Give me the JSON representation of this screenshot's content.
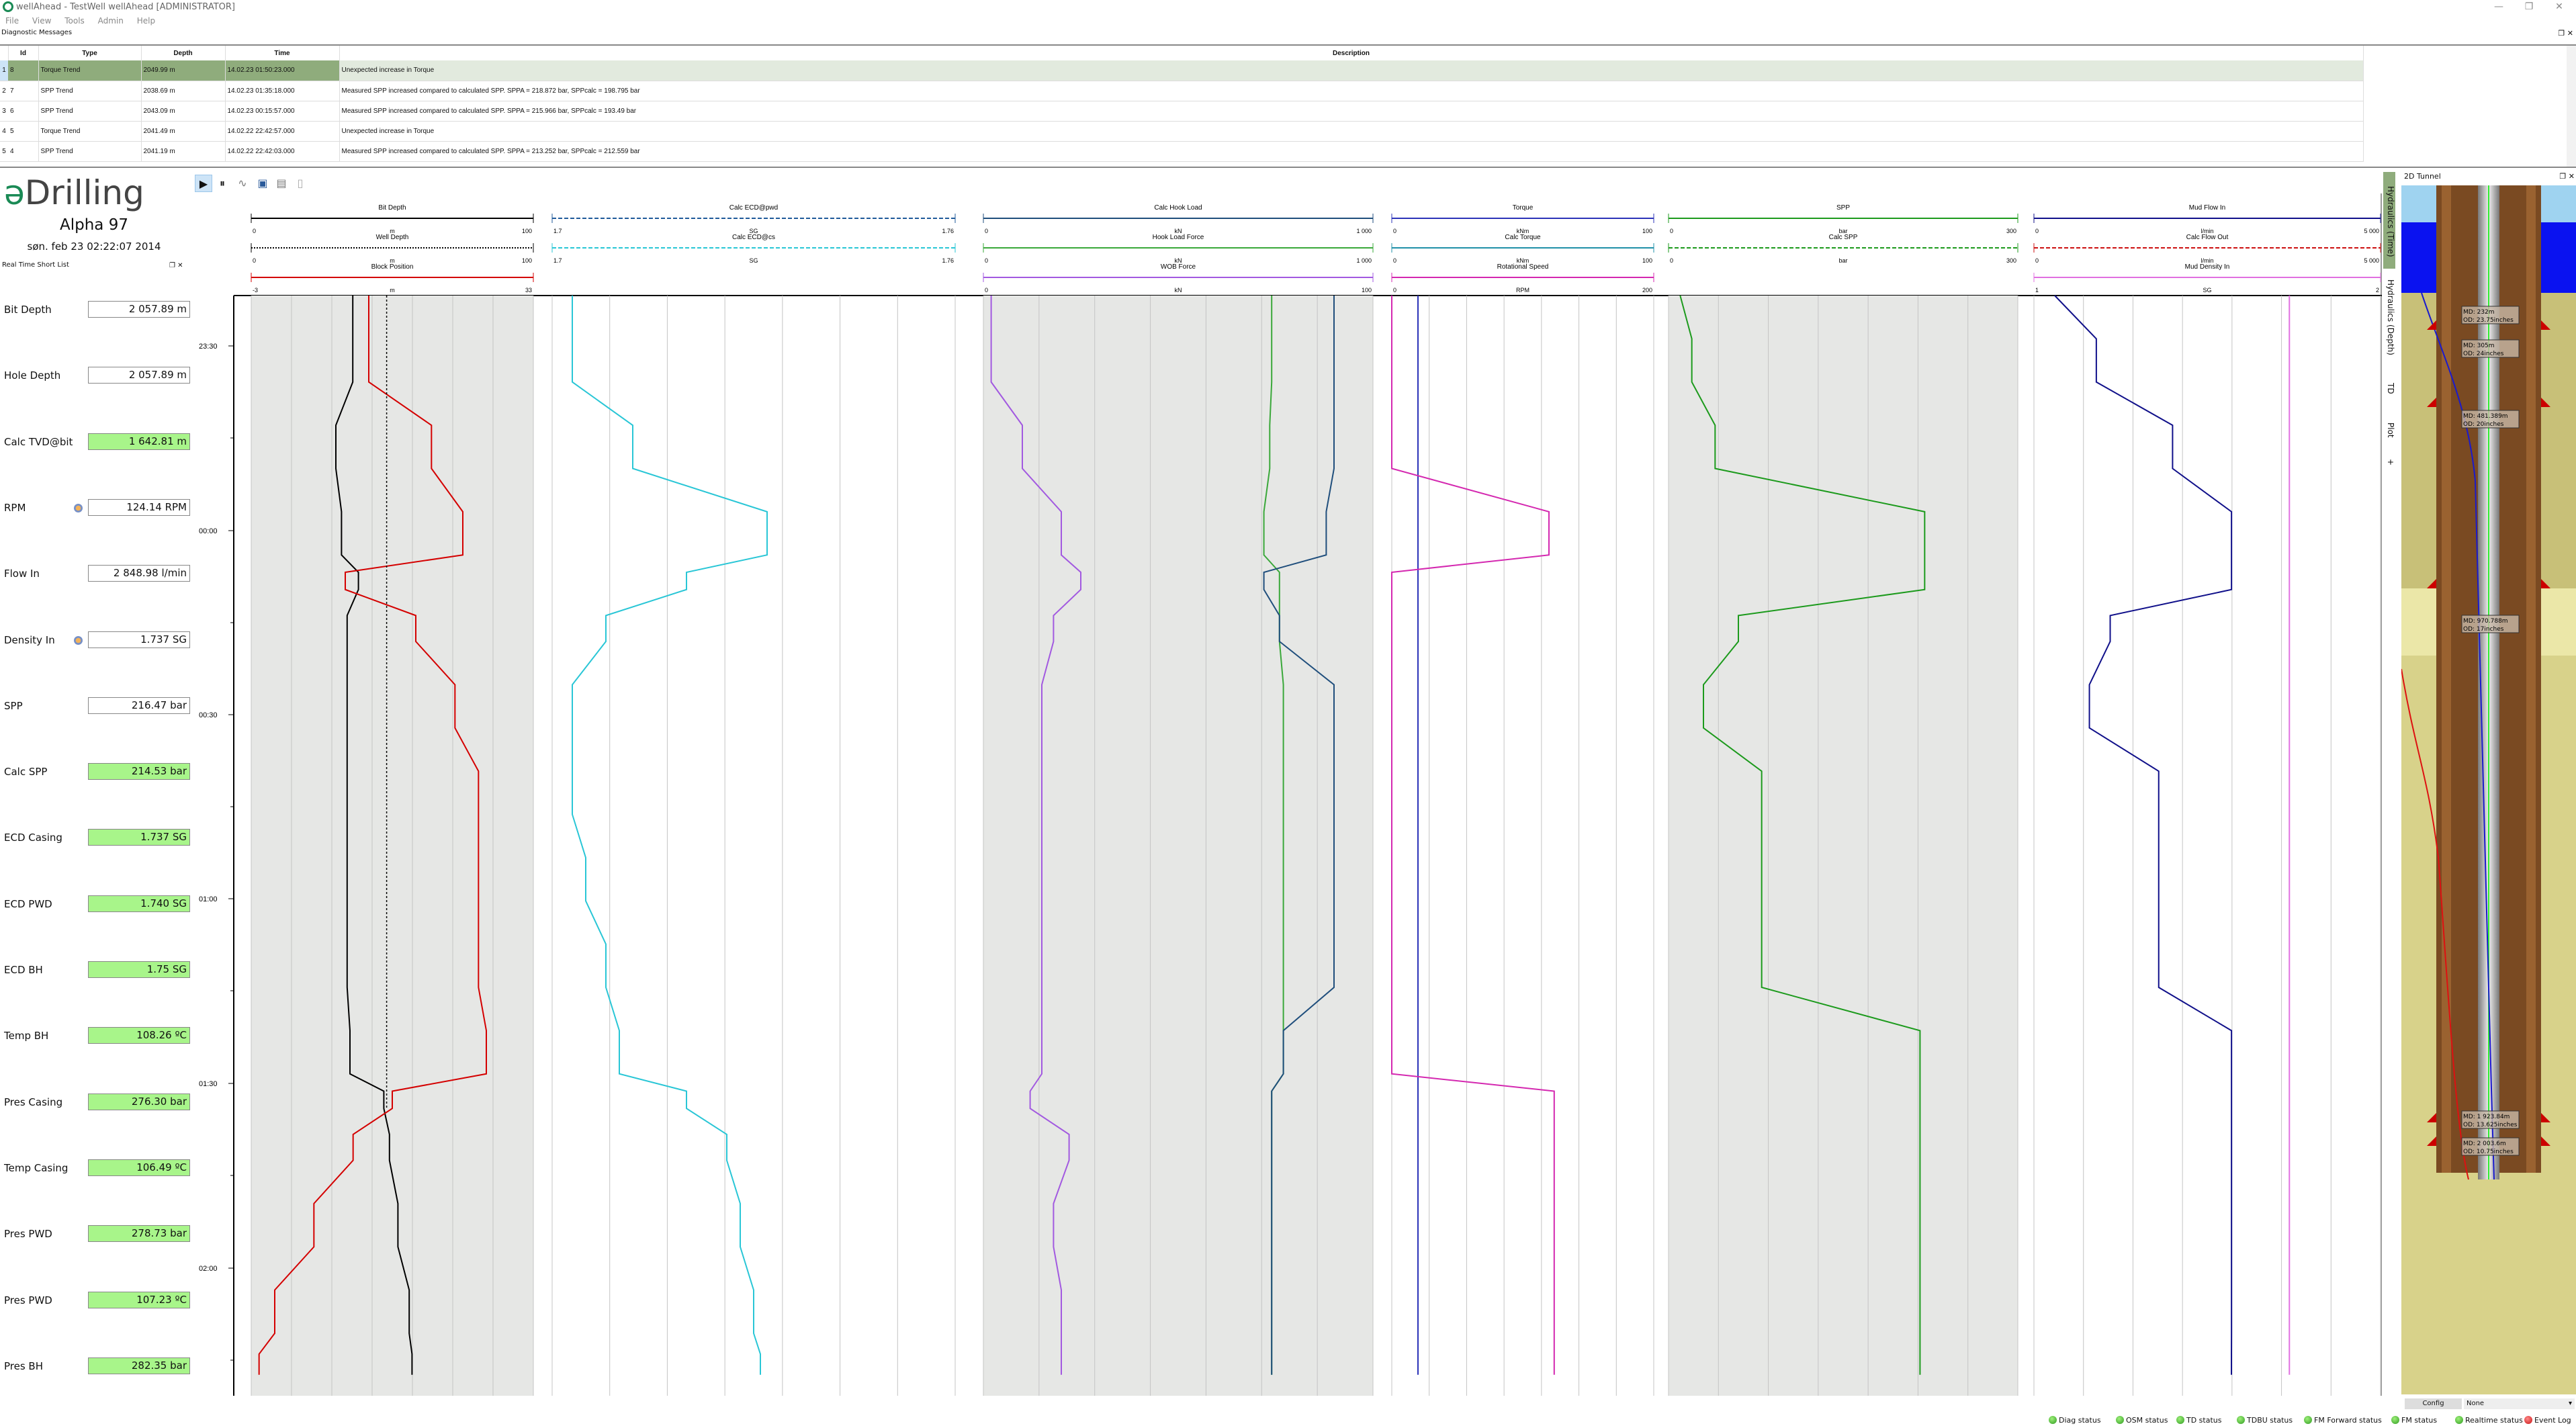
{
  "window": {
    "title": "wellAhead - TestWell wellAhead [ADMINISTRATOR]",
    "controls": {
      "minimize": "—",
      "restore": "❐",
      "close": "✕"
    }
  },
  "menu": [
    "File",
    "View",
    "Tools",
    "Admin",
    "Help"
  ],
  "diagnostics": {
    "panel_title": "Diagnostic Messages",
    "columns": [
      "Id",
      "Type",
      "Depth",
      "Time",
      "Description"
    ],
    "rows": [
      {
        "row": "1",
        "id": "8",
        "type": "Torque Trend",
        "depth": "2049.99 m",
        "time": "14.02.23 01:50:23.000",
        "description": "Unexpected increase in Torque",
        "selected": true
      },
      {
        "row": "2",
        "id": "7",
        "type": "SPP Trend",
        "depth": "2038.69 m",
        "time": "14.02.23 01:35:18.000",
        "description": "Measured SPP increased compared to calculated SPP. SPPA = 218.872 bar, SPPcalc = 198.795 bar"
      },
      {
        "row": "3",
        "id": "6",
        "type": "SPP Trend",
        "depth": "2043.09 m",
        "time": "14.02.23 00:15:57.000",
        "description": "Measured SPP increased compared to calculated SPP. SPPA = 215.966 bar, SPPcalc = 193.49 bar"
      },
      {
        "row": "4",
        "id": "5",
        "type": "Torque Trend",
        "depth": "2041.49 m",
        "time": "14.02.22 22:42:57.000",
        "description": "Unexpected increase in Torque"
      },
      {
        "row": "5",
        "id": "4",
        "type": "SPP Trend",
        "depth": "2041.19 m",
        "time": "14.02.22 22:42:03.000",
        "description": "Measured SPP increased compared to calculated SPP. SPPA = 213.252 bar, SPPcalc = 212.559 bar"
      }
    ]
  },
  "brand": {
    "prefix": "ə",
    "name": "Drilling"
  },
  "rig_name": "Alpha 97",
  "datetime": "søn. feb 23 02:22:07 2014",
  "short_list": {
    "title": "Real Time Short List",
    "items": [
      {
        "label": "Bit Depth",
        "value": "2 057.89 m",
        "status": "normal"
      },
      {
        "label": "Hole Depth",
        "value": "2 057.89 m",
        "status": "normal"
      },
      {
        "label": "Calc TVD@bit",
        "value": "1 642.81 m",
        "status": "ok"
      },
      {
        "label": "RPM",
        "value": "124.14 RPM",
        "status": "normal",
        "gauge": true
      },
      {
        "label": "Flow In",
        "value": "2 848.98 l/min",
        "status": "normal"
      },
      {
        "label": "Density In",
        "value": "1.737 SG",
        "status": "normal",
        "gauge": true
      },
      {
        "label": "SPP",
        "value": "216.47 bar",
        "status": "normal"
      },
      {
        "label": "Calc SPP",
        "value": "214.53 bar",
        "status": "ok"
      },
      {
        "label": "ECD Casing",
        "value": "1.737 SG",
        "status": "ok"
      },
      {
        "label": "ECD PWD",
        "value": "1.740 SG",
        "status": "ok"
      },
      {
        "label": "ECD BH",
        "value": "1.75 SG",
        "status": "ok"
      },
      {
        "label": "Temp BH",
        "value": "108.26 ºC",
        "status": "ok"
      },
      {
        "label": "Pres Casing",
        "value": "276.30 bar",
        "status": "ok"
      },
      {
        "label": "Temp Casing",
        "value": "106.49 ºC",
        "status": "ok"
      },
      {
        "label": "Pres PWD",
        "value": "278.73 bar",
        "status": "ok"
      },
      {
        "label": "Pres PWD",
        "value": "107.23 ºC",
        "status": "ok"
      },
      {
        "label": "Pres BH",
        "value": "282.35 bar",
        "status": "ok"
      }
    ]
  },
  "toolbar": {
    "play": "play-icon",
    "pause": "pause-icon",
    "signal": "wave-icon",
    "save": "save-icon",
    "print": "print-icon",
    "copy": "copy-icon"
  },
  "time_axis": {
    "labels": [
      "23:30",
      "00:00",
      "00:30",
      "01:00",
      "01:30",
      "02:00"
    ]
  },
  "tracks": [
    {
      "id": "depth",
      "shaded": true,
      "curves": [
        {
          "name": "Bit Depth",
          "unit": "m",
          "min": "0",
          "max": "100",
          "color": "#000000",
          "dash": "solid"
        },
        {
          "name": "Well Depth",
          "unit": "m",
          "min": "0",
          "max": "100",
          "color": "#000000",
          "dash": "dotted"
        },
        {
          "name": "Block Position",
          "unit": "m",
          "min": "-3",
          "max": "33",
          "color": "#d40000",
          "dash": "solid"
        }
      ]
    },
    {
      "id": "ecd",
      "shaded": false,
      "curves": [
        {
          "name": "Calc ECD@pwd",
          "unit": "SG",
          "min": "1.7",
          "max": "1.76",
          "color": "#1f5a9a",
          "dash": "dashed"
        },
        {
          "name": "Calc ECD@cs",
          "unit": "SG",
          "min": "1.7",
          "max": "1.76",
          "color": "#29c6d6",
          "dash": "dashed"
        }
      ]
    },
    {
      "id": "hookload",
      "shaded": true,
      "curves": [
        {
          "name": "Calc Hook Load",
          "unit": "kN",
          "min": "0",
          "max": "1 000",
          "color": "#1f4e7c",
          "dash": "solid"
        },
        {
          "name": "Hook Load Force",
          "unit": "kN",
          "min": "0",
          "max": "1 000",
          "color": "#3aa83a",
          "dash": "solid"
        },
        {
          "name": "WOB Force",
          "unit": "kN",
          "min": "0",
          "max": "100",
          "color": "#a259e0",
          "dash": "solid"
        }
      ]
    },
    {
      "id": "torque",
      "shaded": false,
      "curves": [
        {
          "name": "Torque",
          "unit": "kNm",
          "min": "0",
          "max": "100",
          "color": "#2b33b8",
          "dash": "solid"
        },
        {
          "name": "Calc Torque",
          "unit": "kNm",
          "min": "0",
          "max": "100",
          "color": "#2090a8",
          "dash": "solid"
        },
        {
          "name": "Rotational Speed",
          "unit": "RPM",
          "min": "0",
          "max": "200",
          "color": "#d428b0",
          "dash": "solid"
        }
      ]
    },
    {
      "id": "spp",
      "shaded": true,
      "curves": [
        {
          "name": "SPP",
          "unit": "bar",
          "min": "0",
          "max": "300",
          "color": "#1c9a1c",
          "dash": "solid"
        },
        {
          "name": "Calc SPP",
          "unit": "bar",
          "min": "0",
          "max": "300",
          "color": "#1c9a1c",
          "dash": "dashed"
        }
      ]
    },
    {
      "id": "flow",
      "shaded": false,
      "curves": [
        {
          "name": "Mud Flow In",
          "unit": "l/min",
          "min": "0",
          "max": "5 000",
          "color": "#10108a",
          "dash": "solid"
        },
        {
          "name": "Calc Flow Out",
          "unit": "l/min",
          "min": "0",
          "max": "5 000",
          "color": "#cc1010",
          "dash": "dashed"
        },
        {
          "name": "Mud Density In",
          "unit": "SG",
          "min": "1",
          "max": "2",
          "color": "#e070e0",
          "dash": "solid"
        }
      ]
    }
  ],
  "chart_data": {
    "type": "line",
    "title": "Hydraulics (Time)",
    "orientation": "vertical-time",
    "time_range": [
      "23:15",
      "02:22"
    ],
    "y_ticks": [
      "23:30",
      "00:00",
      "00:30",
      "01:00",
      "01:30",
      "02:00"
    ],
    "grid": true,
    "series_time_hours": [
      -0.75,
      -0.5,
      -0.25,
      0.0,
      0.1,
      0.25,
      0.5,
      0.75,
      1.0,
      1.25,
      1.5,
      1.6,
      1.75,
      2.0,
      2.25,
      2.37
    ],
    "series": [
      {
        "name": "Bit Depth (rel m)",
        "track": "depth",
        "values": [
          36,
          36,
          30,
          32,
          38,
          34,
          34,
          34,
          34,
          34,
          35,
          47,
          49,
          52,
          56,
          57
        ]
      },
      {
        "name": "Block Position",
        "track": "depth",
        "values": [
          12,
          12,
          20,
          24,
          9,
          18,
          23,
          26,
          26,
          26,
          27,
          15,
          10,
          5,
          0,
          -2
        ]
      },
      {
        "name": "Calc ECD@cs",
        "track": "ecd",
        "values": [
          1.703,
          1.703,
          1.712,
          1.732,
          1.72,
          1.708,
          1.703,
          1.703,
          1.705,
          1.708,
          1.71,
          1.72,
          1.726,
          1.728,
          1.73,
          1.731
        ]
      },
      {
        "name": "Hook Load Force",
        "track": "hookload",
        "values": [
          740,
          740,
          735,
          720,
          760,
          760,
          770,
          770,
          770,
          770,
          770,
          740,
          740,
          740,
          740,
          740
        ]
      },
      {
        "name": "Calc Hook Load",
        "track": "hookload",
        "values": [
          900,
          900,
          900,
          880,
          720,
          760,
          900,
          900,
          900,
          900,
          770,
          740,
          740,
          740,
          740,
          740
        ]
      },
      {
        "name": "WOB Force",
        "track": "hookload",
        "values": [
          2,
          2,
          10,
          20,
          25,
          18,
          15,
          15,
          15,
          15,
          15,
          12,
          22,
          18,
          20,
          20
        ]
      },
      {
        "name": "Torque",
        "track": "torque",
        "values": [
          10,
          10,
          10,
          10,
          10,
          10,
          10,
          10,
          10,
          10,
          10,
          10,
          10,
          10,
          10,
          10
        ]
      },
      {
        "name": "Rotational Speed",
        "track": "torque",
        "values": [
          0,
          0,
          0,
          120,
          0,
          0,
          0,
          0,
          0,
          0,
          0,
          124,
          124,
          124,
          124,
          124
        ]
      },
      {
        "name": "SPP",
        "track": "spp",
        "values": [
          10,
          20,
          40,
          220,
          220,
          60,
          30,
          80,
          80,
          80,
          216,
          216,
          216,
          216,
          216,
          216
        ]
      },
      {
        "name": "Mud Flow In",
        "track": "flow",
        "values": [
          300,
          900,
          2000,
          2850,
          2850,
          1100,
          800,
          1800,
          1800,
          1800,
          2850,
          2850,
          2850,
          2850,
          2850,
          2849
        ]
      },
      {
        "name": "Mud Density In",
        "track": "flow",
        "values": [
          1.737,
          1.737,
          1.737,
          1.737,
          1.737,
          1.737,
          1.737,
          1.737,
          1.737,
          1.737,
          1.737,
          1.737,
          1.737,
          1.737,
          1.737,
          1.737
        ]
      }
    ]
  },
  "side_tabs": [
    {
      "label": "Hydraulics (Time)",
      "active": true
    },
    {
      "label": "Hydraulics (Depth)",
      "active": false
    },
    {
      "label": "TD",
      "active": false
    },
    {
      "label": "Plot",
      "active": false
    },
    {
      "label": "+",
      "active": false
    }
  ],
  "tunnel": {
    "title": "2D Tunnel",
    "casings": [
      {
        "md": "MD: 232m",
        "od": "OD: 23.75inches"
      },
      {
        "md": "MD: 305m",
        "od": "OD: 24inches"
      },
      {
        "md": "MD: 481.389m",
        "od": "OD: 20inches"
      },
      {
        "md": "MD: 970.788m",
        "od": "OD: 17inches"
      },
      {
        "md": "MD: 1 923.84m",
        "od": "OD: 13.625inches"
      },
      {
        "md": "MD: 2 003.6m",
        "od": "OD: 10.75inches"
      }
    ],
    "config_label": "Config",
    "config_value": "None"
  },
  "status_bar": [
    {
      "label": "Diag status",
      "state": "ok"
    },
    {
      "label": "OSM status",
      "state": "ok"
    },
    {
      "label": "TD status",
      "state": "ok"
    },
    {
      "label": "TDBU status",
      "state": "ok"
    },
    {
      "label": "FM Forward status",
      "state": "ok"
    },
    {
      "label": "FM status",
      "state": "ok"
    },
    {
      "label": "Realtime status",
      "state": "ok"
    },
    {
      "label": "Event Log",
      "state": "error"
    }
  ]
}
